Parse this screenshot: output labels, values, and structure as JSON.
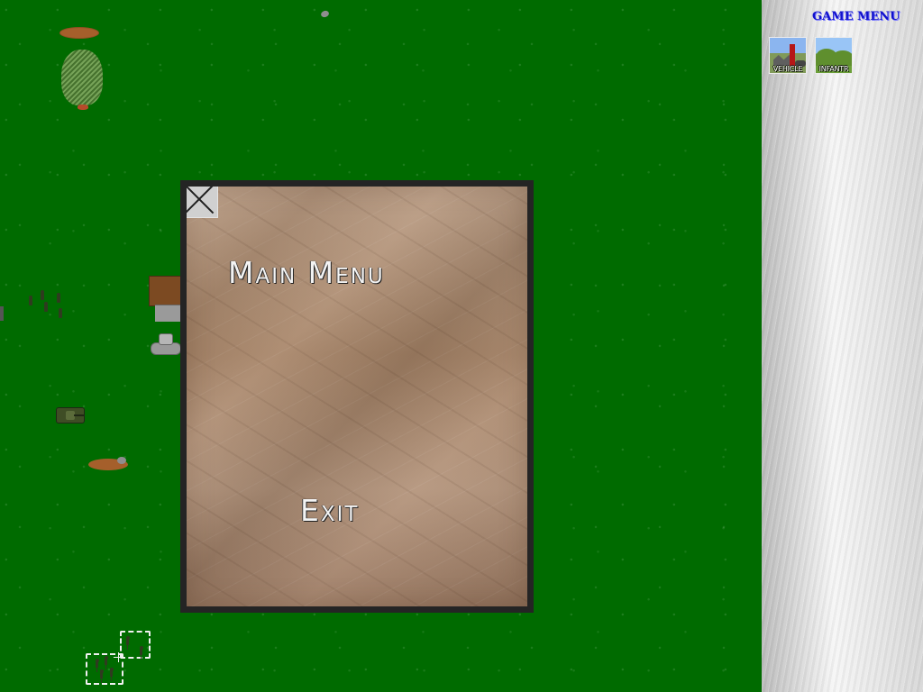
{
  "main_menu": {
    "title": "Main Menu",
    "exit_label": "Exit"
  },
  "game_menu": {
    "title": "GAME MENU",
    "buttons": [
      {
        "label": "Vehicle",
        "icon": "factory-icon"
      },
      {
        "label": "Infantr",
        "icon": "infantry-hills-icon"
      }
    ]
  },
  "colors": {
    "battlefield_green": "#006b00",
    "dialog_border": "#242424",
    "paper_brown": "#a78467",
    "menu_title_blue": "#1111cc"
  },
  "icons": {
    "close": "close-icon",
    "tree": "tree-icon",
    "rock": "rock-icon",
    "tank": "tank-icon",
    "soldier": "soldier-icon",
    "crosshair": "crosshair-icon"
  }
}
